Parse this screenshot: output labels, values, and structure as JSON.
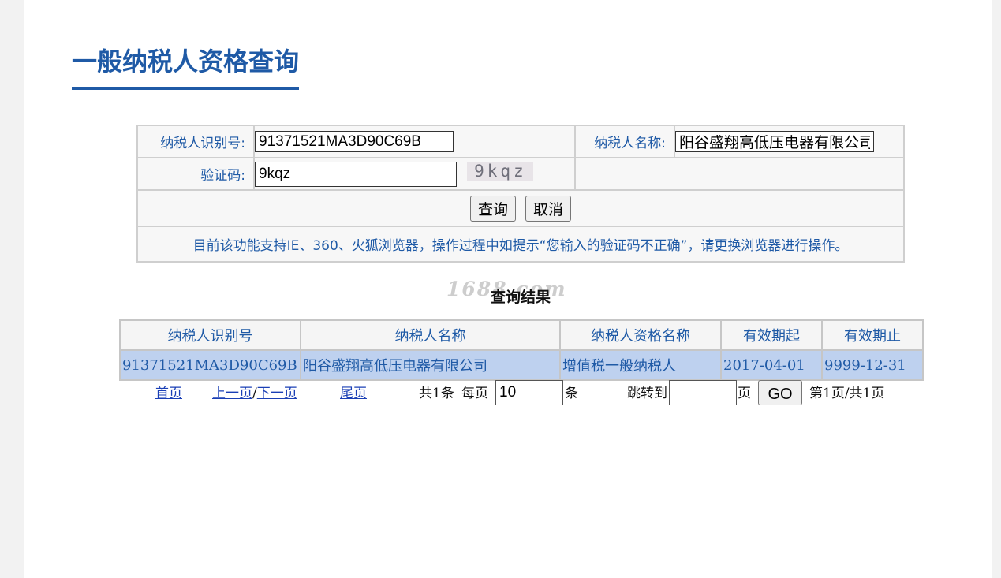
{
  "page": {
    "title": "一般纳税人资格查询"
  },
  "form": {
    "taxpayer_id_label": "纳税人识别号:",
    "taxpayer_id_value": "91371521MA3D90C69B",
    "taxpayer_name_label": "纳税人名称:",
    "taxpayer_name_value": "阳谷盛翔高低压电器有限公司",
    "captcha_label": "验证码:",
    "captcha_value": "9kqz",
    "captcha_image_text": "9kqz",
    "query_button": "查询",
    "cancel_button": "取消",
    "notice": "目前该功能支持IE、360、火狐浏览器，操作过程中如提示“您输入的验证码不正确”，请更换浏览器进行操作。"
  },
  "results": {
    "watermark": "1688.com",
    "title": "查询结果",
    "columns": [
      "纳税人识别号",
      "纳税人名称",
      "纳税人资格名称",
      "有效期起",
      "有效期止"
    ],
    "rows": [
      [
        "91371521MA3D90C69B",
        "阳谷盛翔高低压电器有限公司",
        "增值税一般纳税人",
        "2017-04-01",
        "9999-12-31"
      ]
    ]
  },
  "pager": {
    "first": "首页",
    "prev": "上一页",
    "separator": "/",
    "next": "下一页",
    "last": "尾页",
    "total": "共1条",
    "per_page_label": "每页",
    "per_page_value": "10",
    "per_page_unit": "条",
    "jump_label": "跳转到",
    "jump_value": "",
    "page_unit": "页",
    "go_button": "GO",
    "page_info": "第1页/共1页"
  }
}
